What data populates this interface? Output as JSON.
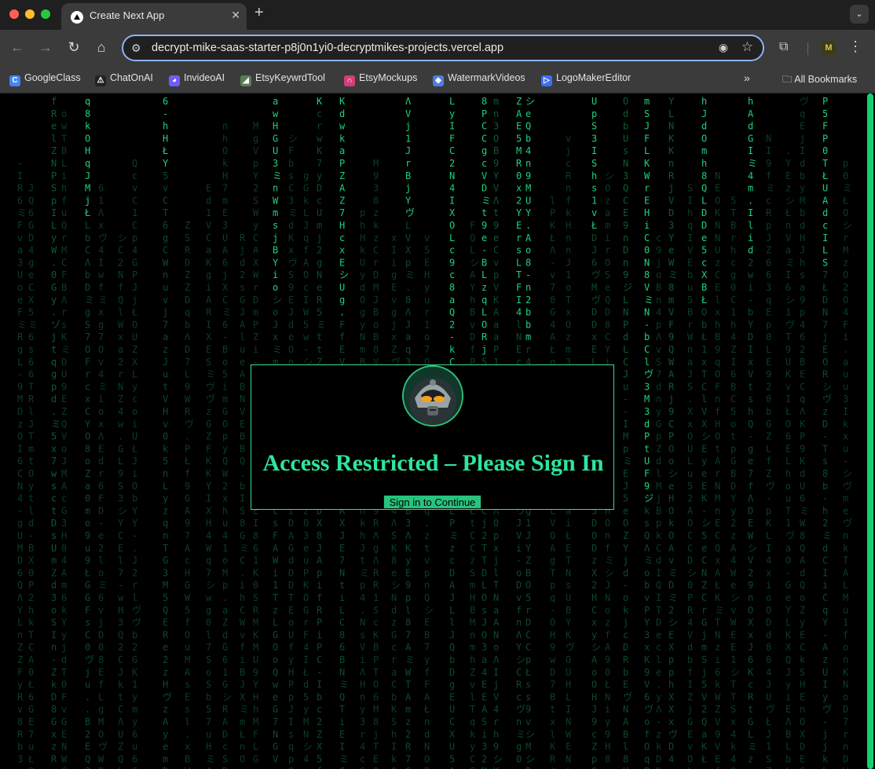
{
  "browser": {
    "tab": {
      "title": "Create Next App",
      "close": "✕"
    },
    "new_tab": "+",
    "tab_menu": "⌄",
    "nav": {
      "back": "←",
      "forward": "→",
      "reload": "↻",
      "home": "⌂"
    },
    "address": {
      "url": "decrypt-mike-saas-starter-p8j0n1yi0-decryptmikes-projects.vercel.app"
    },
    "icons": {
      "site_info": "⚙",
      "eye": "◉",
      "star": "☆",
      "extensions": "⧉",
      "profile": "M",
      "menu": "⋮"
    }
  },
  "bookmarks": {
    "items": [
      {
        "label": "GoogleClass",
        "icon": "C",
        "color": "#4285f4"
      },
      {
        "label": "ChatOnAI",
        "icon": "⚠",
        "color": "#222222"
      },
      {
        "label": "InvideoAI",
        "icon": "◕",
        "color": "#6d5dfc"
      },
      {
        "label": "EtsyKeywrdTool",
        "icon": "◢",
        "color": "#5a7d5a"
      },
      {
        "label": "EtsyMockups",
        "icon": "∩",
        "color": "#d63c7a"
      },
      {
        "label": "WatermarkVideos",
        "icon": "◆",
        "color": "#4f7de0"
      },
      {
        "label": "LogoMakerEditor",
        "icon": "▷",
        "color": "#3b6ef0"
      }
    ],
    "more": "»",
    "all_bookmarks": "All Bookmarks"
  },
  "colors": {
    "accent": "#2ee59d",
    "button": "#27c47e",
    "matrix": "#1fcf7a"
  },
  "modal": {
    "title": "Access Restricted – Please Sign In",
    "button": "Sign in to Continue",
    "avatar": "robot-avatar"
  },
  "matrix": {
    "columns": [
      {
        "text": "fRelZNPSpILyW.0Gy.ゾjtqgpd.ミ5x7wsctDsU",
        "bright": 0
      },
      {
        "text": "q8kOHqJMjŁ",
        "bright": 10
      },
      {
        "text": "6-hHŁY",
        "bright": 6
      },
      {
        "text": "awHGU3ミnWmsjBYio",
        "bright": 17
      },
      {
        "text": "K",
        "bright": 1
      },
      {
        "text": "KdwkaPZAZ7HcxEシUg.",
        "bright": 19
      },
      {
        "text": "ΛVj1JrBjYヴ",
        "bright": 10
      },
      {
        "text": "LyIFC2N4IXOLc9c8aQ2-kCa2-Kc9SCRSa",
        "bright": 34
      },
      {
        "text": "8PCCgcVDミt9e-BLzqLORj",
        "bright": 22
      },
      {
        "text": "mn3OB9YVΛt9e",
        "bright": 0
      },
      {
        "text": "ZAE5MR0x2YErsLTFI4",
        "bright": 18
      },
      {
        "text": "シeQb4n9MUY.Ao8-n2bbm",
        "bright": 20
      },
      {
        "text": "UpS3IShs1vŁ",
        "bright": 11
      },
      {
        "text": "OdbUsN3QCE9nDn9ジLNPdLCJ",
        "bright": 0
      },
      {
        "text": "mSJFLKWrEHiC0N8VミN-bClヴ3M3dPtUF9ジ",
        "bright": 34
      },
      {
        "text": "YLNKKnRjVD3YeWミ8mVF9QWARj9CP",
        "bright": 0
      },
      {
        "text": "hJdOmh8QLDDe5cXBŁ",
        "bright": 17
      },
      {
        "text": "hAdGIミ4m.Ilid",
        "bright": 13
      },
      {
        "text": "P5FP0TŁUAdcILS",
        "bright": 14
      }
    ],
    "dim": "ABCDEFGHIJKLMNOPQRSTUVWXYZ0123456789ミシヴΛ-.ŁabcdefghijklmnopqrstuvwxyzCODE"
  }
}
